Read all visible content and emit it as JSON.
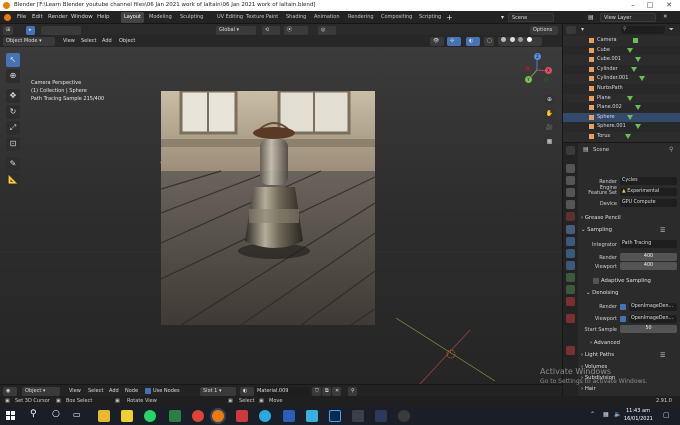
{
  "window_title": "Blender [F:\\Learn Blender youtube channel files\\06 Jan 2021 work of laltain\\06 Jan 2021 work of laltain.blend]",
  "menus": [
    "File",
    "Edit",
    "Render",
    "Window",
    "Help"
  ],
  "workspaces": [
    "Layout",
    "Modeling",
    "Sculpting",
    "UV Editing",
    "Texture Paint",
    "Shading",
    "Animation",
    "Rendering",
    "Compositing",
    "Scripting"
  ],
  "active_workspace": "Layout",
  "scene_name": "Scene",
  "view_layer_name": "View Layer",
  "viewport_header": {
    "mode": "Object Mode",
    "menus": [
      "View",
      "Select",
      "Add",
      "Object"
    ],
    "transform_orientation": "Global",
    "options": "Options"
  },
  "viewport_overlay": {
    "line1": "Camera Perspective",
    "line2": "(1) Collection | Sphere",
    "line3": "Path Tracing Sample 215/400"
  },
  "outliner": {
    "search_placeholder": "",
    "items": [
      "Camera",
      "Cube",
      "Cube.001",
      "Cylinder",
      "Cylinder.001",
      "NurbsPath",
      "Plane",
      "Plane.002",
      "Sphere",
      "Sphere.001",
      "Torus"
    ],
    "selected": "Sphere"
  },
  "properties": {
    "scene_label": "Scene",
    "render_engine_label": "Render Engine",
    "render_engine": "Cycles",
    "feature_set_label": "Feature Set",
    "feature_set": "Experimental",
    "device_label": "Device",
    "device": "GPU Compute",
    "grease_pencil": "Grease Pencil",
    "sampling": "Sampling",
    "integrator_label": "Integrator",
    "integrator": "Path Tracing",
    "render_label": "Render",
    "render_samples": "400",
    "viewport_label": "Viewport",
    "viewport_samples": "400",
    "adaptive_sampling": "Adaptive Sampling",
    "denoising": "Denoising",
    "denoise_render_label": "Render",
    "denoise_render": "OpenImageDen...",
    "denoise_viewport_label": "Viewport",
    "denoise_viewport": "OpenImageDen...",
    "start_sample_label": "Start Sample",
    "start_sample": "50",
    "advanced": "Advanced",
    "light_paths": "Light Paths",
    "volumes": "Volumes",
    "subdivision": "Subdivision",
    "hair": "Hair"
  },
  "bottom_bar": {
    "editor_mode": "Object",
    "menus": [
      "View",
      "Select",
      "Add",
      "Node"
    ],
    "use_nodes": "Use Nodes",
    "slot": "Slot 1",
    "material": "Material.009"
  },
  "status_bar": {
    "hint1": "Set 3D Cursor",
    "hint2": "Box Select",
    "hint3": "Rotate View",
    "hint4": "Select",
    "hint5": "Move",
    "version": "2.91.0"
  },
  "activate_windows": {
    "line1": "Activate Windows",
    "line2": "Go to Settings to activate Windows."
  },
  "taskbar": {
    "time": "11:43 am",
    "date": "16/01/2021"
  },
  "colors": {
    "accent": "#4772b3",
    "blender_orange": "#e87d0d",
    "object_icon": "#e8a060",
    "mesh_green": "#6dbd55"
  }
}
